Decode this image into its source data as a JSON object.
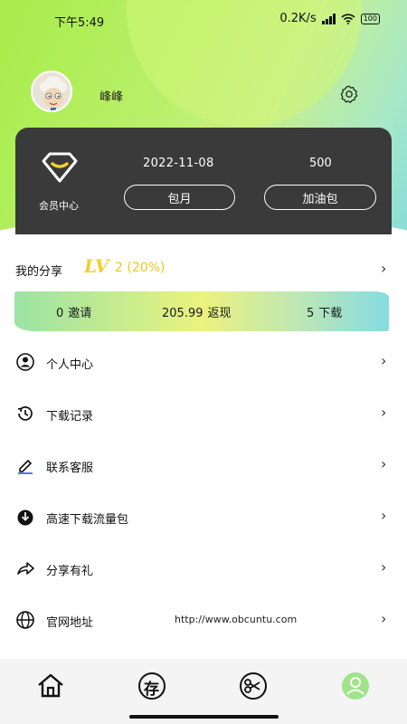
{
  "status_bar": {
    "time": "下午5:49",
    "net_speed": "0.2K/s",
    "battery": "100",
    "hd_label": "HD"
  },
  "profile": {
    "username": "峰峰",
    "avatar_icon": "cartoon-sheep-avatar",
    "settings_icon": "gear-icon"
  },
  "vip": {
    "label": "会员中心",
    "expiry_date": "2022-11-08",
    "count": "500",
    "monthly_button": "包月",
    "addon_button": "加油包"
  },
  "share": {
    "title": "我的分享",
    "lv_text": "LV",
    "level_text": "2 (20%)",
    "stats": [
      {
        "value": "0",
        "label": "邀请"
      },
      {
        "value": "205.99",
        "label": "返现"
      },
      {
        "value": "5",
        "label": "下载"
      }
    ]
  },
  "menu": [
    {
      "label": "个人中心",
      "icon": "person-circle-icon",
      "value": ""
    },
    {
      "label": "下载记录",
      "icon": "history-icon",
      "value": ""
    },
    {
      "label": "联系客服",
      "icon": "edit-pencil-icon",
      "value": ""
    },
    {
      "label": "高速下载流量包",
      "icon": "download-circle-icon",
      "value": ""
    },
    {
      "label": "分享有礼",
      "icon": "share-arrow-icon",
      "value": ""
    },
    {
      "label": "官网地址",
      "icon": "globe-icon",
      "value": "http://www.obcuntu.com"
    }
  ],
  "tabbar": {
    "tabs": [
      {
        "name": "home",
        "icon": "home-icon",
        "glyph": ""
      },
      {
        "name": "store",
        "icon": "store-seal-icon",
        "glyph": "存"
      },
      {
        "name": "cut",
        "icon": "scissors-icon",
        "glyph": ""
      },
      {
        "name": "profile",
        "icon": "profile-icon",
        "glyph": ""
      }
    ],
    "active": "profile"
  },
  "colors": {
    "header_green": "#a8ec4a",
    "header_teal": "#86dcd9",
    "card_dark": "#3a3a3a",
    "level_yellow": "#f2cf2e",
    "active_tab": "#9fe48a"
  }
}
